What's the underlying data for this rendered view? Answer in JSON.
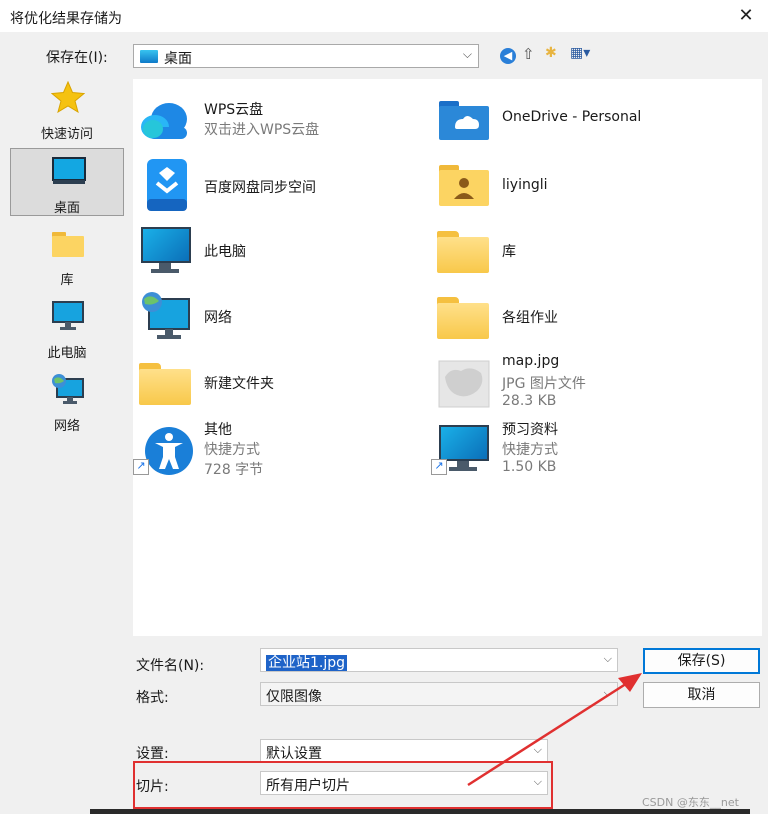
{
  "dialog": {
    "title": "将优化结果存储为",
    "close_glyph": "✕"
  },
  "location": {
    "label": "保存在(I):",
    "value": "桌面"
  },
  "sidebar": {
    "items": [
      {
        "label": "快速访问",
        "icon": "star-icon"
      },
      {
        "label": "桌面",
        "icon": "desktop-icon",
        "selected": true
      },
      {
        "label": "库",
        "icon": "folder-icon"
      },
      {
        "label": "此电脑",
        "icon": "computer-icon"
      },
      {
        "label": "网络",
        "icon": "network-icon"
      }
    ]
  },
  "files": [
    {
      "name": "WPS云盘",
      "sub1": "双击进入WPS云盘",
      "icon": "cloud-icon"
    },
    {
      "name": "OneDrive - Personal",
      "icon": "onedrive-folder-icon"
    },
    {
      "name": "百度网盘同步空间",
      "icon": "baidu-netdisk-icon"
    },
    {
      "name": "liyingli",
      "icon": "user-folder-icon"
    },
    {
      "name": "此电脑",
      "icon": "computer-icon"
    },
    {
      "name": "库",
      "icon": "library-folder-icon"
    },
    {
      "name": "网络",
      "icon": "network-icon"
    },
    {
      "name": "各组作业",
      "icon": "folder-icon"
    },
    {
      "name": "新建文件夹",
      "icon": "folder-icon"
    },
    {
      "name": "map.jpg",
      "sub1": "JPG 图片文件",
      "sub2": "28.3 KB",
      "icon": "image-file-icon"
    },
    {
      "name": "其他",
      "sub1": "快捷方式",
      "sub2": "728 字节",
      "icon": "accessibility-shortcut-icon"
    },
    {
      "name": "预习资料",
      "sub1": "快捷方式",
      "sub2": "1.50 KB",
      "icon": "monitor-shortcut-icon"
    }
  ],
  "form": {
    "filename_label": "文件名(N):",
    "filename_value": "企业站1.jpg",
    "format_label": "格式:",
    "format_value": "仅限图像",
    "settings_label": "设置:",
    "settings_value": "默认设置",
    "slices_label": "切片:",
    "slices_value": "所有用户切片"
  },
  "buttons": {
    "save": "保存(S)",
    "cancel": "取消"
  },
  "colors": {
    "annotation_red": "#e03030",
    "accent_blue": "#0078d7"
  },
  "watermark": "CSDN @东东__net"
}
